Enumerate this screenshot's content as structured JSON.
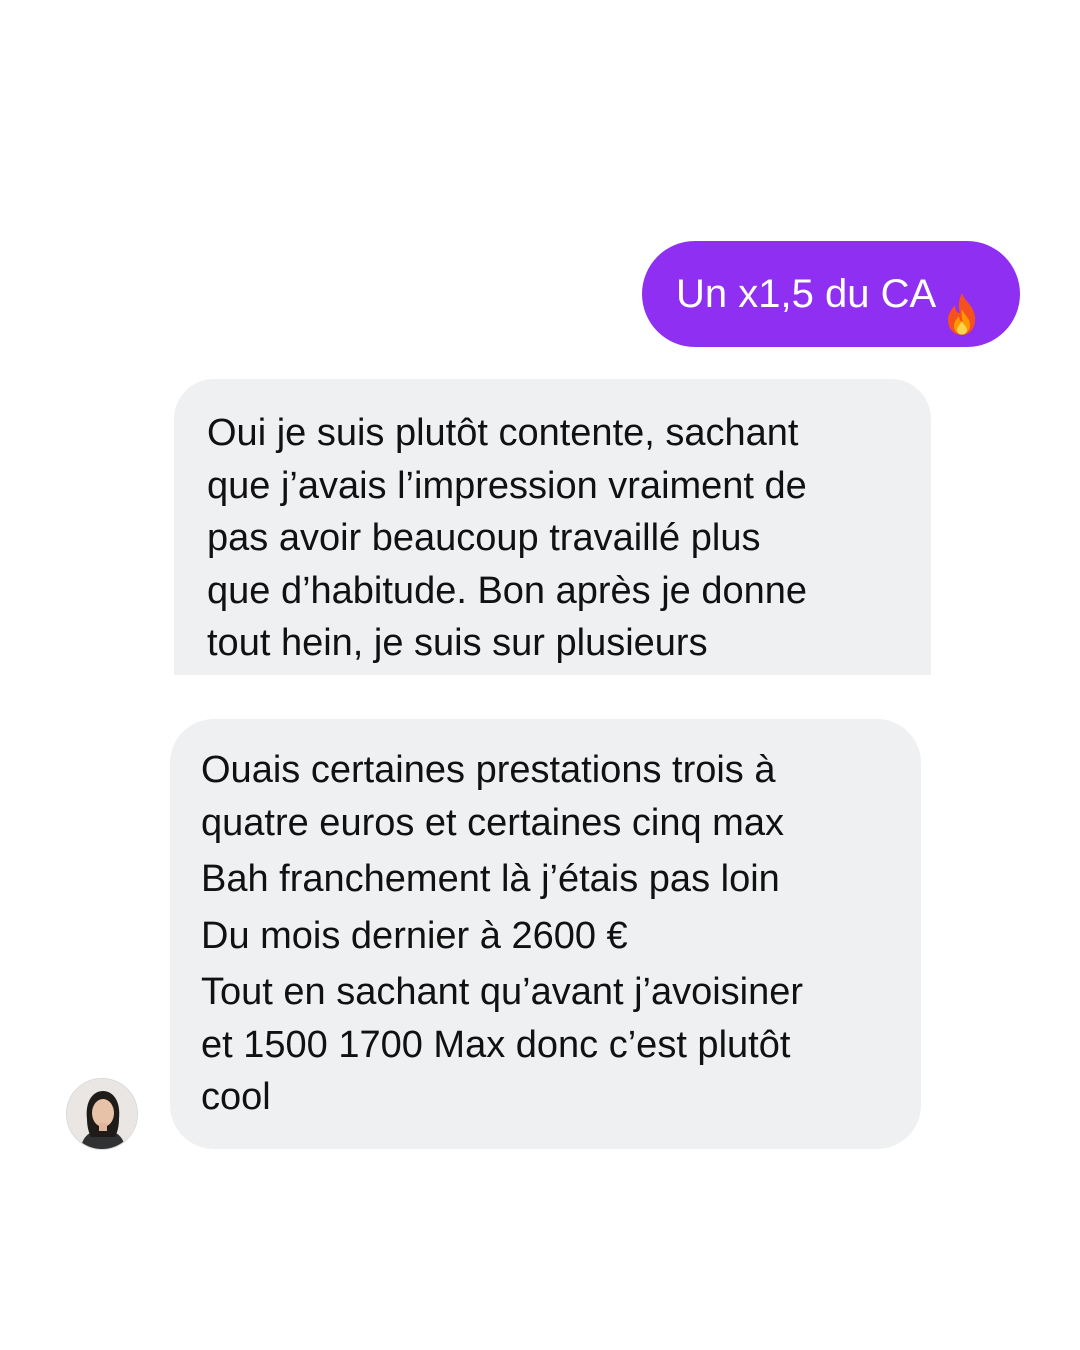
{
  "messages": {
    "sent": {
      "text": "Un x1,5 du CA",
      "emoji": "flame-icon",
      "bubble_color": "#8f2ff2",
      "text_color": "#ffffff"
    },
    "received_1": {
      "bubble_color": "#eef0f2",
      "lines": [
        "Oui je suis plutôt contente, sachant",
        "que j’avais l’impression vraiment de",
        "pas avoir beaucoup travaillé plus",
        "que d’habitude. Bon après je donne",
        "tout hein, je suis sur plusieurs"
      ]
    },
    "received_2": {
      "bubble_color": "#eef0f2",
      "lines": [
        "Ouais certaines prestations trois à",
        "quatre euros et certaines cinq max",
        "Bah franchement là j’étais pas loin",
        "Du mois dernier à 2600 €",
        "Tout en sachant qu’avant j’avoisiner",
        "et 1500 1700 Max donc c’est plutôt",
        "cool"
      ]
    }
  },
  "contact": {
    "avatar": "avatar"
  }
}
